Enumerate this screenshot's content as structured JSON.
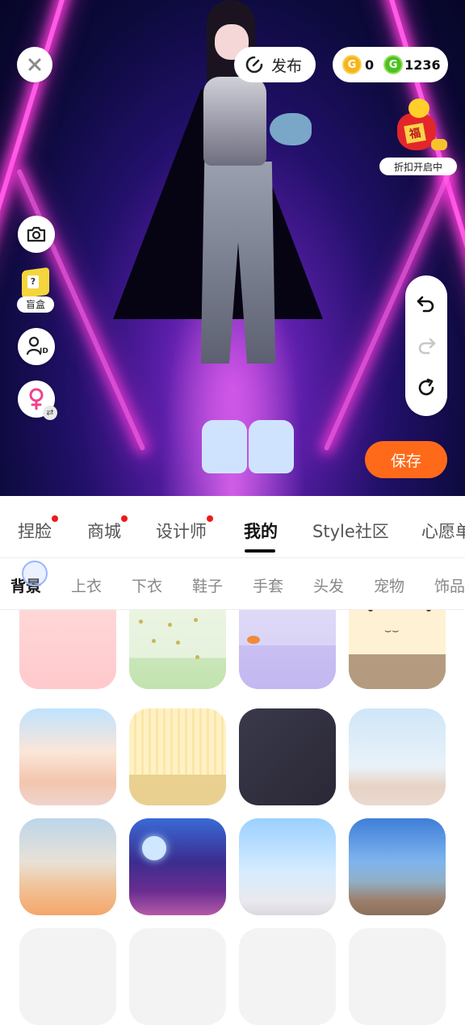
{
  "header": {
    "publish_label": "发布",
    "currency_gold_value": "0",
    "currency_green_value": "1236",
    "promo_label": "折扣开启中",
    "promo_icon": "fortune-bag-icon"
  },
  "left_tools": {
    "blindbox_label": "盲盒",
    "id_badge": "ID"
  },
  "actions": {
    "save_label": "保存"
  },
  "main_tabs": [
    {
      "label": "捏脸",
      "dot": true
    },
    {
      "label": "商城",
      "dot": true
    },
    {
      "label": "设计师",
      "dot": true
    },
    {
      "label": "我的",
      "dot": false,
      "active": true
    },
    {
      "label": "Style社区",
      "dot": false
    },
    {
      "label": "心愿单",
      "dot": false
    }
  ],
  "sub_tabs": [
    {
      "label": "背景",
      "active": true
    },
    {
      "label": "上衣"
    },
    {
      "label": "下衣"
    },
    {
      "label": "鞋子"
    },
    {
      "label": "手套"
    },
    {
      "label": "头发"
    },
    {
      "label": "宠物"
    },
    {
      "label": "饰品"
    }
  ],
  "backgrounds": [
    {
      "name": "pink-solid"
    },
    {
      "name": "green-dots"
    },
    {
      "name": "lavender-space"
    },
    {
      "name": "bear-face"
    },
    {
      "name": "palace-hall"
    },
    {
      "name": "yellow-stripes"
    },
    {
      "name": "dark-slate"
    },
    {
      "name": "window-room"
    },
    {
      "name": "desert-dunes"
    },
    {
      "name": "night-city-moon"
    },
    {
      "name": "cloud-window"
    },
    {
      "name": "city-rooftop"
    }
  ],
  "colors": {
    "accent_orange": "#ff6a1a",
    "notify_red": "#f01818",
    "coin_gold": "#f6b51a",
    "coin_green": "#4cc21f"
  }
}
